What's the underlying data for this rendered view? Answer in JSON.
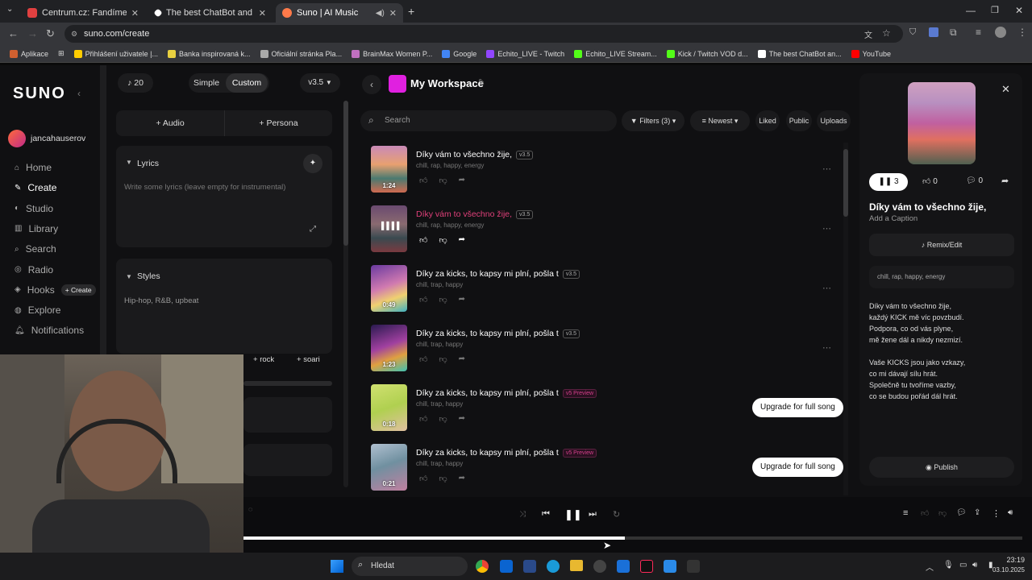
{
  "browser": {
    "tabs": [
      {
        "title": "Centrum.cz: Fandíme dobrému",
        "fav": "#e04040"
      },
      {
        "title": "The best ChatBot and Widgets",
        "fav": "#ffffff"
      },
      {
        "title": "Suno | AI Music",
        "fav": "#ff7a4a"
      }
    ],
    "url": "suno.com/create",
    "bookmarks": [
      {
        "label": "Aplikace",
        "c": "#d06030"
      },
      {
        "label": "Přihlášení uživatele |...",
        "c": "#ffcc00"
      },
      {
        "label": "Banka inspirovaná k...",
        "c": "#e8d040"
      },
      {
        "label": "Oficiální stránka Pla...",
        "c": "#aaaaaa"
      },
      {
        "label": "BrainMax Women P...",
        "c": "#c070c0"
      },
      {
        "label": "Google",
        "c": "#4285f4"
      },
      {
        "label": "Echito_LIVE - Twitch",
        "c": "#9146ff"
      },
      {
        "label": "Echito_LIVE Stream...",
        "c": "#53fc18"
      },
      {
        "label": "Kick / Twitch VOD d...",
        "c": "#53fc18"
      },
      {
        "label": "The best ChatBot an...",
        "c": "#ffffff"
      },
      {
        "label": "YouTube",
        "c": "#ff0000"
      }
    ]
  },
  "app": {
    "logo": "SUNO",
    "credits": "20",
    "mode_simple": "Simple",
    "mode_custom": "Custom",
    "version": "v3.5",
    "user": "jancahauserov",
    "nav": [
      {
        "label": "Home",
        "icon": "home-icon"
      },
      {
        "label": "Create",
        "icon": "create-icon"
      },
      {
        "label": "Studio",
        "icon": "studio-icon"
      },
      {
        "label": "Library",
        "icon": "library-icon"
      },
      {
        "label": "Search",
        "icon": "search-icon"
      },
      {
        "label": "Radio",
        "icon": "radio-icon"
      },
      {
        "label": "Hooks",
        "icon": "hooks-icon"
      },
      {
        "label": "Explore",
        "icon": "explore-icon"
      },
      {
        "label": "Notifications",
        "icon": "bell-icon"
      }
    ],
    "hooks_create": "+ Create",
    "audio_btn": "Audio",
    "persona_btn": "Persona",
    "lyrics_label": "Lyrics",
    "lyrics_placeholder": "Write some lyrics (leave empty for instrumental)",
    "styles_label": "Styles",
    "styles_value": "Hip-hop, R&B, upbeat",
    "style_tags": [
      "rock",
      "soari"
    ],
    "workspace": "My Workspace",
    "search_placeholder": "Search",
    "filters": "Filters (3)",
    "sort": "Newest",
    "chips": [
      "Liked",
      "Public",
      "Uploads"
    ],
    "upgrade": "Upgrade for full song",
    "songs": [
      {
        "title": "Díky vám to všechno žije,",
        "version": "v3.5",
        "tags": "chill, rap, happy, energy",
        "dur": "1:24",
        "playing": false,
        "preview": false,
        "g": "linear-gradient(180deg,#c98ab8 0%,#e8a070 40%,#4a7a70 70%,#d06a50 100%)"
      },
      {
        "title": "Díky vám to všechno žije,",
        "version": "v3.5",
        "tags": "chill, rap, happy, energy",
        "dur": "",
        "playing": true,
        "preview": false,
        "g": "linear-gradient(180deg,#6a4a70 0%,#8a6a70 40%,#3a4a50 70%,#7a3a40 100%)"
      },
      {
        "title": "Díky za kicks, to kapsy mi plní, pošla t",
        "version": "v3.5",
        "tags": "chill, trap, happy",
        "dur": "0:49",
        "playing": false,
        "preview": false,
        "g": "linear-gradient(160deg,#6a3aa0 0%,#d07ab0 45%,#f0d070 70%,#40b0c0 100%)"
      },
      {
        "title": "Díky za kicks, to kapsy mi plní, pošla t",
        "version": "v3.5",
        "tags": "chill, trap, happy",
        "dur": "1:23",
        "playing": false,
        "preview": false,
        "g": "linear-gradient(160deg,#2a1a50 0%,#a040a0 45%,#e0a040 70%,#40c0b0 100%)"
      },
      {
        "title": "Díky za kicks, to kapsy mi plní, pošla t",
        "version": "v5 Preview",
        "tags": "chill, trap, happy",
        "dur": "0:18",
        "playing": false,
        "preview": true,
        "g": "linear-gradient(160deg,#d0e070 0%,#b0d050 50%,#e0c0a0 100%)"
      },
      {
        "title": "Díky za kicks, to kapsy mi plní, pošla t",
        "version": "v5 Preview",
        "tags": "chill, trap, happy",
        "dur": "0:21",
        "playing": false,
        "preview": true,
        "g": "linear-gradient(160deg,#b0c0d0 0%,#7090a0 45%,#c080a0 100%)"
      }
    ],
    "detail": {
      "plays": "3",
      "likes": "0",
      "comments": "0",
      "title": "Díky vám to všechno žije,",
      "caption": "Add a Caption",
      "remix": "Remix/Edit",
      "tags": "chill, rap, happy, energy",
      "lyrics": [
        "Díky vám to všechno žije,",
        "každý KICK mě víc povzbudí.",
        "Podpora, co od vás plyne,",
        "mě žene dál a nikdy nezmizí.",
        "",
        "Vaše KICKS jsou jako vzkazy,",
        "co mi dávají sílu hrát.",
        "Společně tu tvoříme vazby,",
        "co se budou pořád dál hrát."
      ],
      "publish": "Publish"
    },
    "player_progress": 0.49
  },
  "taskbar": {
    "search": "Hledat",
    "time": "23:19",
    "date": "03.10.2025"
  }
}
